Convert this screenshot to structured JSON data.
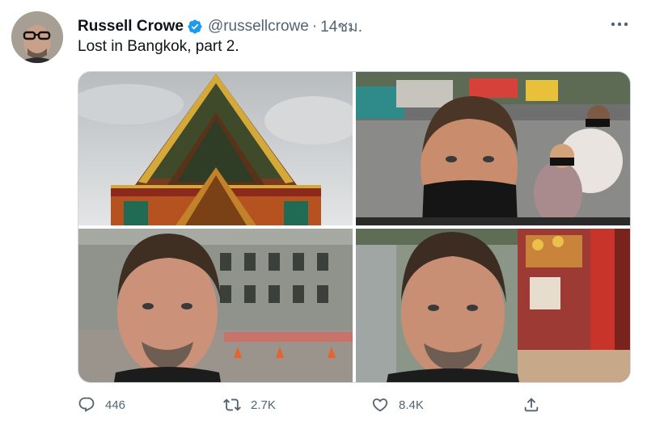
{
  "tweet": {
    "author_name": "Russell Crowe",
    "handle": "@russellcrowe",
    "separator": "·",
    "time": "14ชม.",
    "text": "Lost in Bangkok, part 2."
  },
  "media": {
    "photos": [
      {
        "subject": "thai-temple-roof"
      },
      {
        "subject": "street-selfie-with-mask"
      },
      {
        "subject": "selfie-old-building"
      },
      {
        "subject": "selfie-shrine-shop"
      }
    ]
  },
  "actions": {
    "reply_count": "446",
    "retweet_count": "2.7K",
    "like_count": "8.4K"
  },
  "colors": {
    "verified": "#1d9bf0",
    "secondary_text": "#536471",
    "border": "#cfd9de"
  }
}
